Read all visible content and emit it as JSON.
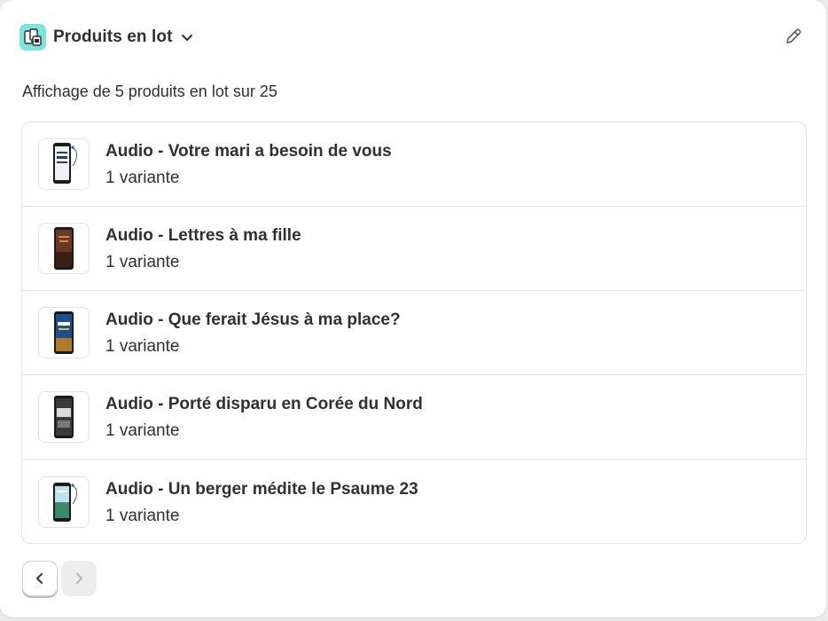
{
  "header": {
    "title": "Produits en lot",
    "app_icon": "bundle-app-icon",
    "dropdown_icon": "chevron-down-icon",
    "edit_icon": "pencil-icon"
  },
  "summary": "Affichage de 5 produits en lot sur 25",
  "products": [
    {
      "name": "Audio - Votre mari a besoin de vous",
      "variants": "1 variante",
      "screen_color": "#eef1f5",
      "accent": "#2c3e50"
    },
    {
      "name": "Audio - Lettres à ma fille",
      "variants": "1 variante",
      "screen_color": "#6b3a25",
      "accent": "#c98a5a"
    },
    {
      "name": "Audio - Que ferait Jésus à ma place?",
      "variants": "1 variante",
      "screen_color": "#1c4f8f",
      "accent": "#e8b54a"
    },
    {
      "name": "Audio - Porté disparu en Corée du Nord",
      "variants": "1 variante",
      "screen_color": "#3a3a3a",
      "accent": "#d9d9d9"
    },
    {
      "name": "Audio - Un berger médite le Psaume 23",
      "variants": "1 variante",
      "screen_color": "#3d8a6a",
      "accent": "#bfe0ef"
    }
  ],
  "pagination": {
    "prev_icon": "chevron-left-icon",
    "next_icon": "chevron-right-icon"
  }
}
